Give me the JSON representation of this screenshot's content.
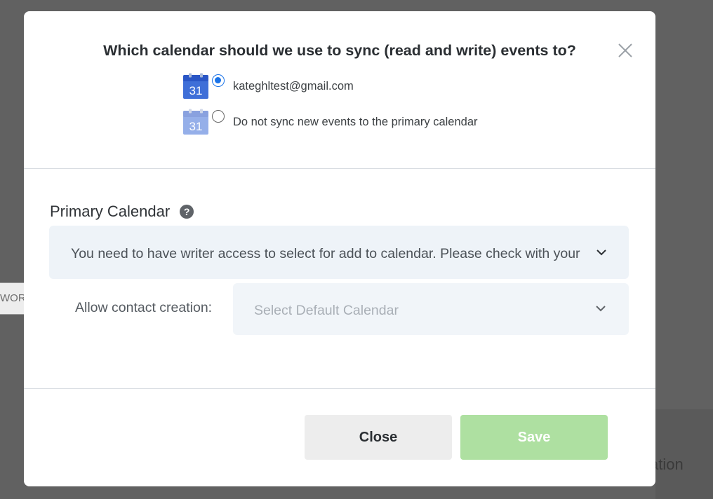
{
  "background": {
    "tab_text": "WORK",
    "lower_text": "ation"
  },
  "modal": {
    "title": "Which calendar should we use to sync (read and write) events to?",
    "close_icon": "close-icon",
    "calendar_options": [
      {
        "label": "kateghltest@gmail.com",
        "selected": true,
        "icon": "google-calendar-icon",
        "icon_text": "31"
      },
      {
        "label": "Do not sync new events to the primary calendar",
        "selected": false,
        "icon": "google-calendar-icon",
        "icon_text": "31"
      }
    ],
    "primary_calendar": {
      "title": "Primary Calendar",
      "help_icon": "help-icon",
      "access_message": "You need to have writer access to select for add to calendar. Please check with your admin",
      "contact_creation_label": "Allow contact creation:",
      "default_calendar_placeholder": "Select Default Calendar"
    },
    "buttons": {
      "close": "Close",
      "save": "Save"
    }
  },
  "colors": {
    "accent_blue": "#1a73e8",
    "save_green": "#aee0a1",
    "select_bg": "#eef3f8"
  }
}
